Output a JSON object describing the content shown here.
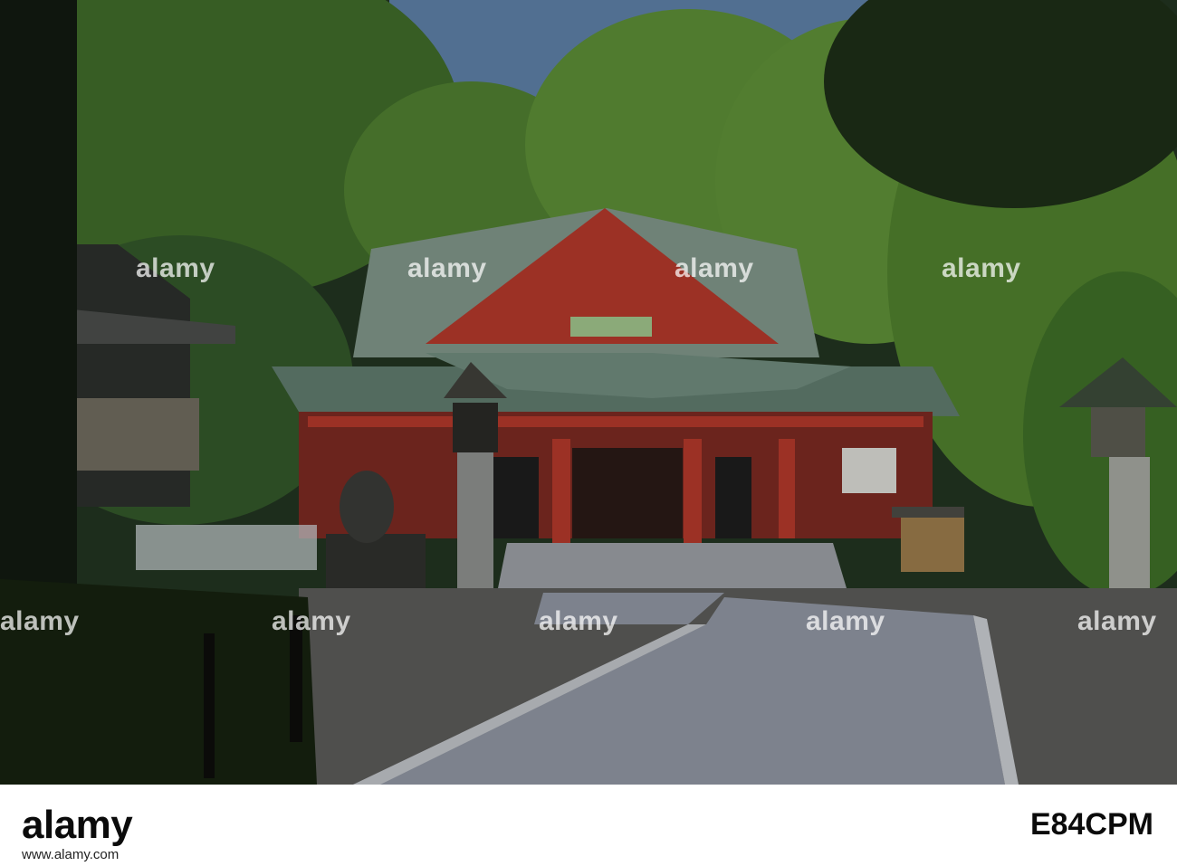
{
  "watermarks": {
    "brand": "alamy",
    "tiles": [
      "alamy",
      "alamy",
      "alamy",
      "alamy",
      "alamy",
      "alamy",
      "alamy",
      "alamy",
      "alamy",
      "alamy"
    ]
  },
  "footer": {
    "logo": "alamy",
    "url": "www.alamy.com",
    "image_code": "E84CPM"
  },
  "colors": {
    "roof": "#7f9488",
    "shrine_red": "#b2382b",
    "foliage_dark": "#243a1c",
    "foliage_light": "#6c9a3f",
    "sky": "#5d7fa6",
    "path": "#8f95a1"
  }
}
